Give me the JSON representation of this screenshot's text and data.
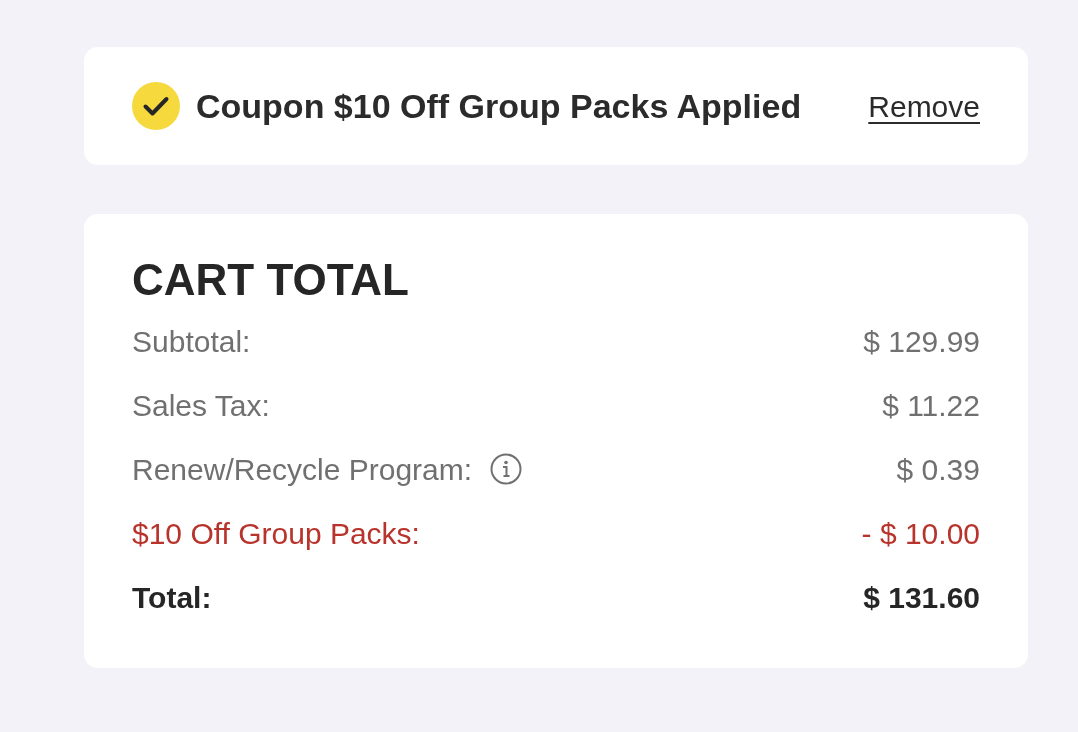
{
  "coupon": {
    "applied": true,
    "text": "Coupon $10 Off Group Packs Applied",
    "action": "Remove"
  },
  "cart_total": {
    "title": "CART TOTAL",
    "rows": [
      {
        "kind": "line",
        "label": "Subtotal:",
        "info": false,
        "amount": "$ 129.99"
      },
      {
        "kind": "line",
        "label": "Sales Tax:",
        "info": false,
        "amount": "$ 11.22"
      },
      {
        "kind": "line",
        "label": "Renew/Recycle Program:",
        "info": true,
        "amount": "$ 0.39"
      },
      {
        "kind": "discount",
        "label": "$10 Off Group Packs:",
        "info": false,
        "amount": "- $ 10.00"
      },
      {
        "kind": "total",
        "label": "Total:",
        "info": false,
        "amount": "$ 131.60"
      }
    ]
  }
}
